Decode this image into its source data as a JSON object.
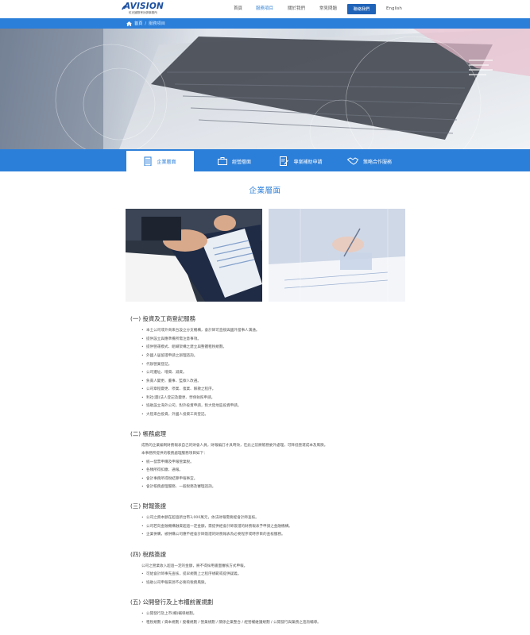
{
  "header": {
    "logo_text": "AVISION",
    "logo_sub": "虹光國際會計師事務所",
    "nav": [
      "首頁",
      "服務項目",
      "關於我們",
      "常見問題"
    ],
    "contact": "聯絡我們",
    "lang": "English"
  },
  "breadcrumb": {
    "home": "首頁",
    "sep": "/",
    "current": "服務項目"
  },
  "tabs": [
    "企業層面",
    "經營層面",
    "專案補助申請",
    "策略合作服務"
  ],
  "section_title": "企業層面",
  "sections": [
    {
      "title": "(一) 投資及工商登記服務",
      "items": [
        "本土公司或外商來台設立分支機構，會計師可直接與國外當事人溝通。",
        "提供設立與應準備所需注意事項。",
        "提供營運模式、組織架構之建立與整體租稅規劃。",
        "外國人居留證申請之辦理諮詢。",
        "代辦營業登記。",
        "公司遷址、增資、減資。",
        "負責人變更、董事、監察人改選。",
        "公司章程變更、停業、復業、解散之程序。",
        "利社(團)法人登記及變更、勞保執照申請。",
        "協助設立海外公司，對外投資申請，對大陸地區投資申請。",
        "大陸來台投資，外國人投資工商登記。"
      ]
    },
    {
      "title": "(二) 帳務處理",
      "paras": [
        "成熟的企業編制財務報表自己的財會人員，財報編訂才具時效，在此之前將帳務委外處理，可降低營運成本及風險。",
        "本事務所提供的帳務處理服務項目如下："
      ],
      "items": [
        "統一發票申購及申報營業稅。",
        "各類所得扣繳、通報。",
        "會計事務所得稅結算申報事宜。",
        "會計帳務處理服務、一般稅務及審理諮詢。"
      ]
    },
    {
      "title": "(三) 財報簽證",
      "items": [
        "公司之資本額在超過新台幣3,000萬元，依法財報需要經會計師查核。",
        "公司若向金融機構融資超過一定金額，需提供經會計師簽證的財務報表予申請之金融機構。",
        "企業併購，被併購公司應不經會計師簽證的財務報表為必要程序或時序目的查核服務。"
      ]
    },
    {
      "title": "(四) 稅務簽證",
      "paras": [
        "公司之營業收入超過一定的金額，將不得採用書面審核方式申報。"
      ],
      "items": [
        "可給會計師事先查核，提早規劃上之程序規範或提供疑義。",
        "協助公司申報來源不必要的稅務風險。"
      ]
    },
    {
      "title": "(五) 公開發行及上市櫃前置規劃",
      "items": [
        "公開發行及上市(櫃)輔導規劃。",
        "租稅規劃 / 資本規劃 / 股權規劃 / 營業規劃 / 關係企業整合 / 經營權維護規劃 / 公開發行與業務之諮詢輔導。"
      ]
    }
  ]
}
